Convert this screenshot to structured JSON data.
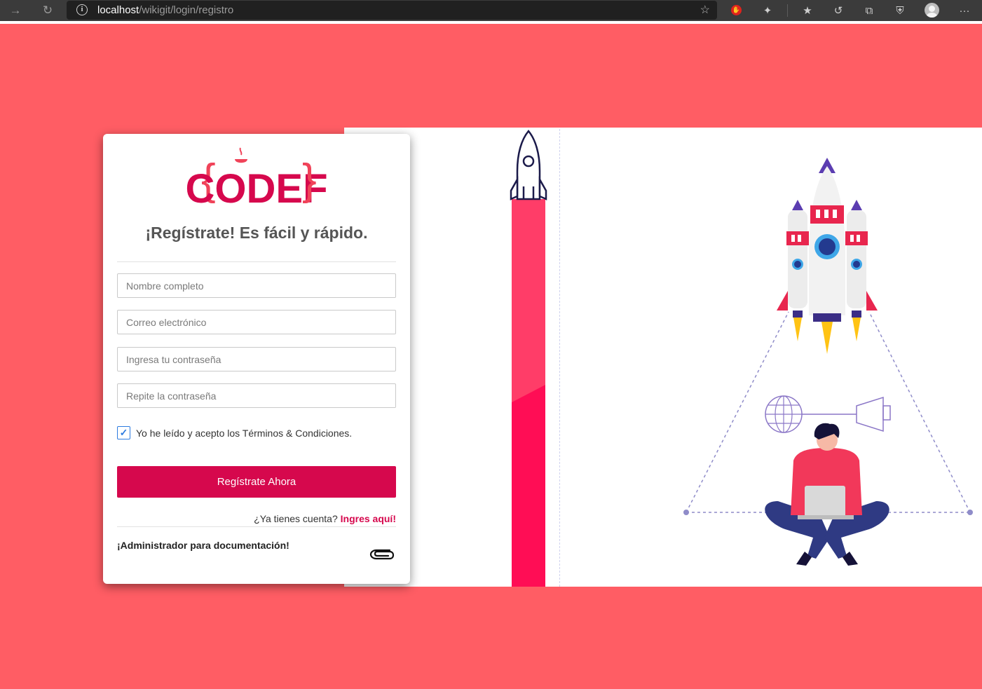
{
  "browser": {
    "url_host": "localhost",
    "url_path": "/wikigit/login/registro",
    "more_label": "···"
  },
  "brand": {
    "logo_text": "CODEF",
    "accent": "#d6084d",
    "background": "#ff5d64"
  },
  "form": {
    "title": "¡Regístrate! Es fácil y rápido.",
    "fields": {
      "full_name_placeholder": "Nombre completo",
      "email_placeholder": "Correo electrónico",
      "password_placeholder": "Ingresa tu contraseña",
      "repeat_password_placeholder": "Repite la contraseña"
    },
    "terms_label": "Yo he leído y acepto los Términos & Condiciones.",
    "terms_checked": true,
    "submit_label": "Regístrate Ahora",
    "login_prompt": "¿Ya tienes cuenta?",
    "login_link": "Ingres aquí!",
    "admin_label": "¡Administrador para documentación!"
  },
  "icons": [
    "back-arrow-icon",
    "reload-icon",
    "info-icon",
    "favorite-add-icon",
    "adblock-icon",
    "extension-icon",
    "favorites-icon",
    "history-icon",
    "collections-icon",
    "shield-icon",
    "profile-avatar-icon",
    "more-icon",
    "paperclip-icon"
  ]
}
